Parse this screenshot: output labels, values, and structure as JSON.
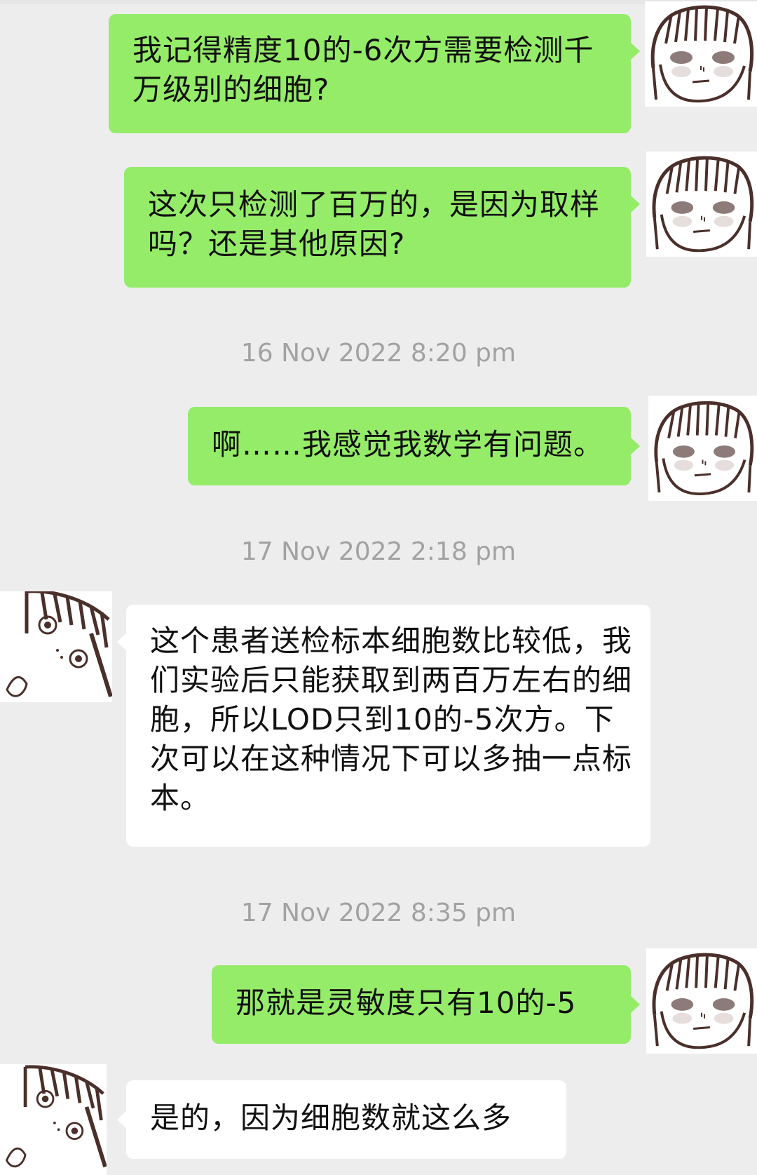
{
  "messages": [
    {
      "side": "out",
      "text": "我记得精度10的-6次方需要检测千万级别的细胞?"
    },
    {
      "side": "out",
      "text": "这次只检测了百万的，是因为取样吗？还是其他原因?"
    },
    {
      "side": "out",
      "text": "啊……我感觉我数学有问题。"
    },
    {
      "side": "in",
      "text": "这个患者送检标本细胞数比较低，我们实验后只能获取到两百万左右的细胞，所以LOD只到10的-5次方。下次可以在这种情况下可以多抽一点标本。"
    },
    {
      "side": "out",
      "text": "那就是灵敏度只有10的-5"
    },
    {
      "side": "in",
      "text": "是的，因为细胞数就这么多"
    }
  ],
  "timestamps": [
    "16 Nov 2022 8:20 pm",
    "17 Nov 2022 2:18 pm",
    "17 Nov 2022 8:35 pm"
  ],
  "colors": {
    "background": "#ededed",
    "outgoing_bubble": "#95ec69",
    "incoming_bubble": "#ffffff",
    "timestamp_text": "#a2a2a2"
  },
  "icons": {
    "self_avatar": "cartoon-girl-bangs-avatar-icon",
    "contact_avatar": "cartoon-girl-peeking-avatar-icon"
  }
}
